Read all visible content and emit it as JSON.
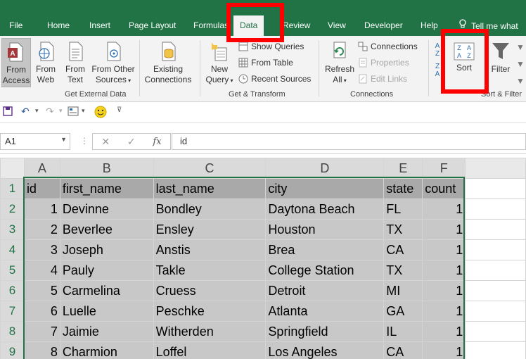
{
  "tabs": [
    {
      "label": "File",
      "active": false
    },
    {
      "label": "Home",
      "active": false
    },
    {
      "label": "Insert",
      "active": false
    },
    {
      "label": "Page Layout",
      "active": false
    },
    {
      "label": "Formulas",
      "active": false
    },
    {
      "label": "Data",
      "active": true
    },
    {
      "label": "Review",
      "active": false
    },
    {
      "label": "View",
      "active": false
    },
    {
      "label": "Developer",
      "active": false
    },
    {
      "label": "Help",
      "active": false
    }
  ],
  "tell_me": "Tell me what",
  "ribbon": {
    "get_external": {
      "from_access": [
        "From",
        "Access"
      ],
      "from_web": [
        "From",
        "Web"
      ],
      "from_text": [
        "From",
        "Text"
      ],
      "from_other": [
        "From Other",
        "Sources"
      ],
      "existing": [
        "Existing",
        "Connections"
      ],
      "label": "Get External Data"
    },
    "get_transform": {
      "new_query": [
        "New",
        "Query"
      ],
      "show_queries": "Show Queries",
      "from_table": "From Table",
      "recent_sources": "Recent Sources",
      "label": "Get & Transform"
    },
    "connections": {
      "refresh": [
        "Refresh",
        "All"
      ],
      "connections": "Connections",
      "properties": "Properties",
      "edit_links": "Edit Links",
      "label": "Connections"
    },
    "sort_filter": {
      "sort": "Sort",
      "filter": "Filter",
      "label": "Sort & Filter"
    }
  },
  "namebox": "A1",
  "formula": "id",
  "columns": [
    "A",
    "B",
    "C",
    "D",
    "E",
    "F"
  ],
  "rows": [
    {
      "n": "1",
      "cells": [
        "id",
        "first_name",
        "last_name",
        "city",
        "state",
        "count"
      ]
    },
    {
      "n": "2",
      "cells": [
        "1",
        "Devinne",
        "Bondley",
        "Daytona Beach",
        "FL",
        "1"
      ]
    },
    {
      "n": "3",
      "cells": [
        "2",
        "Beverlee",
        "Ensley",
        "Houston",
        "TX",
        "1"
      ]
    },
    {
      "n": "4",
      "cells": [
        "3",
        "Joseph",
        "Anstis",
        "Brea",
        "CA",
        "1"
      ]
    },
    {
      "n": "5",
      "cells": [
        "4",
        "Pauly",
        "Takle",
        "College Station",
        "TX",
        "1"
      ]
    },
    {
      "n": "6",
      "cells": [
        "5",
        "Carmelina",
        "Cruess",
        "Detroit",
        "MI",
        "1"
      ]
    },
    {
      "n": "7",
      "cells": [
        "6",
        "Luelle",
        "Peschke",
        "Atlanta",
        "GA",
        "1"
      ]
    },
    {
      "n": "8",
      "cells": [
        "7",
        "Jaimie",
        "Witherden",
        "Springfield",
        "IL",
        "1"
      ]
    },
    {
      "n": "9",
      "cells": [
        "8",
        "Charmion",
        "Loffel",
        "Los Angeles",
        "CA",
        "1"
      ]
    }
  ],
  "colors": {
    "accent": "#217346",
    "highlight": "#ff0000",
    "selection": "#c8c8c8"
  }
}
